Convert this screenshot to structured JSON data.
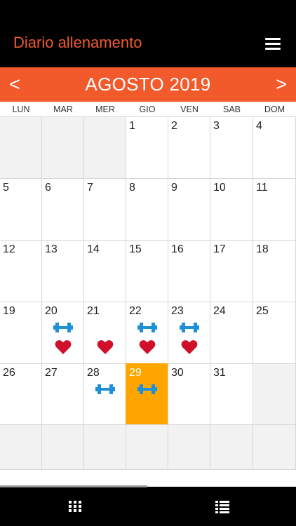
{
  "header": {
    "title": "Diario allenamento",
    "menu_icon": "hamburger-menu-icon"
  },
  "month_bar": {
    "prev_label": "<",
    "next_label": ">",
    "title": "AGOSTO 2019"
  },
  "weekdays": [
    "LUN",
    "MAR",
    "MER",
    "GIO",
    "VEN",
    "SAB",
    "DOM"
  ],
  "calendar": {
    "weeks": [
      [
        {
          "day": "",
          "outside": true
        },
        {
          "day": "",
          "outside": true
        },
        {
          "day": "",
          "outside": true
        },
        {
          "day": "1"
        },
        {
          "day": "2"
        },
        {
          "day": "3"
        },
        {
          "day": "4"
        }
      ],
      [
        {
          "day": "5"
        },
        {
          "day": "6"
        },
        {
          "day": "7"
        },
        {
          "day": "8"
        },
        {
          "day": "9"
        },
        {
          "day": "10"
        },
        {
          "day": "11"
        }
      ],
      [
        {
          "day": "12"
        },
        {
          "day": "13"
        },
        {
          "day": "14"
        },
        {
          "day": "15"
        },
        {
          "day": "16"
        },
        {
          "day": "17"
        },
        {
          "day": "18"
        }
      ],
      [
        {
          "day": "19"
        },
        {
          "day": "20",
          "workout": true,
          "heart": true
        },
        {
          "day": "21",
          "heart": true
        },
        {
          "day": "22",
          "workout": true,
          "heart": true
        },
        {
          "day": "23",
          "workout": true,
          "heart": true
        },
        {
          "day": "24"
        },
        {
          "day": "25"
        }
      ],
      [
        {
          "day": "26"
        },
        {
          "day": "27"
        },
        {
          "day": "28",
          "workout": true
        },
        {
          "day": "29",
          "workout": true,
          "today": true
        },
        {
          "day": "30"
        },
        {
          "day": "31"
        },
        {
          "day": "",
          "outside": true
        }
      ],
      [
        {
          "day": "",
          "outside": true
        },
        {
          "day": "",
          "outside": true
        },
        {
          "day": "",
          "outside": true
        },
        {
          "day": "",
          "outside": true
        },
        {
          "day": "",
          "outside": true
        },
        {
          "day": "",
          "outside": true
        },
        {
          "day": "",
          "outside": true
        }
      ]
    ]
  },
  "colors": {
    "accent": "#f25a2c",
    "today": "#ffa500",
    "dumbbell": "#1e90d8",
    "heart": "#d0102a"
  },
  "tabbar": {
    "items": [
      {
        "icon": "calendar-grid-icon"
      },
      {
        "icon": "list-icon"
      }
    ]
  }
}
